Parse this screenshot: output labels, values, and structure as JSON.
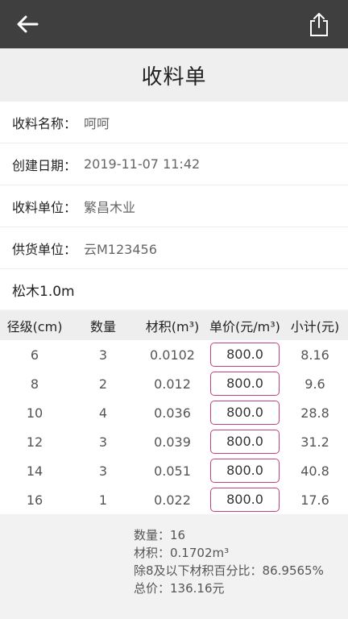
{
  "header": {
    "title": "收料单"
  },
  "info": {
    "name_label": "收料名称：",
    "name_value": "呵呵",
    "date_label": "创建日期：",
    "date_value": "2019-11-07 11:42",
    "receiver_label": "收料单位：",
    "receiver_value": "繁昌木业",
    "supplier_label": "供货单位：",
    "supplier_value": "云M123456"
  },
  "item_name": "松木1.0m",
  "table": {
    "headers": [
      "径级(cm)",
      "数量",
      "材积(m³)",
      "单价(元/m³)",
      "小计(元)"
    ],
    "rows": [
      {
        "diameter": "6",
        "qty": "3",
        "volume": "0.0102",
        "price": "800.0",
        "subtotal": "8.16"
      },
      {
        "diameter": "8",
        "qty": "2",
        "volume": "0.012",
        "price": "800.0",
        "subtotal": "9.6"
      },
      {
        "diameter": "10",
        "qty": "4",
        "volume": "0.036",
        "price": "800.0",
        "subtotal": "28.8"
      },
      {
        "diameter": "12",
        "qty": "3",
        "volume": "0.039",
        "price": "800.0",
        "subtotal": "31.2"
      },
      {
        "diameter": "14",
        "qty": "3",
        "volume": "0.051",
        "price": "800.0",
        "subtotal": "40.8"
      },
      {
        "diameter": "16",
        "qty": "1",
        "volume": "0.022",
        "price": "800.0",
        "subtotal": "17.6"
      }
    ]
  },
  "summary": {
    "quantity": "数量：16",
    "volume": "材积：0.1702m³",
    "percent": "除8及以下材积百分比：86.9565%",
    "total": "总价：136.16元"
  },
  "colors": {
    "topbar": "#3f3f3f",
    "price_border": "#c4407e"
  },
  "icons": {
    "back": "back-arrow-icon",
    "share": "share-icon"
  }
}
